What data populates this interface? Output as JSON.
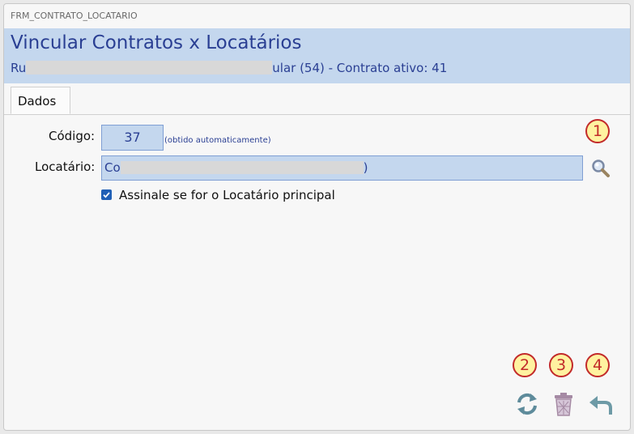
{
  "window": {
    "form_id": "FRM_CONTRATO_LOCATARIO"
  },
  "header": {
    "title": "Vincular Contratos x Locatários",
    "subtitle_prefix": "Ru",
    "subtitle_suffix": "ular (54) - Contrato ativo: 41"
  },
  "tabs": [
    {
      "label": "Dados",
      "active": true
    }
  ],
  "form": {
    "codigo_label": "Código:",
    "codigo_value": "37",
    "codigo_hint": "(obtido automaticamente)",
    "locatario_label": "Locatário:",
    "locatario_value_prefix": "Co",
    "locatario_value_suffix": ")",
    "principal_checkbox_label": "Assinale se for o Locatário principal",
    "principal_checked": true
  },
  "markers": [
    "1",
    "2",
    "3",
    "4"
  ],
  "actions": [
    {
      "icon": "refresh-icon"
    },
    {
      "icon": "trash-icon"
    },
    {
      "icon": "back-arrow-icon"
    }
  ],
  "colors": {
    "header_bg": "#c4d7ee",
    "title_text": "#2a3f93",
    "field_bg": "#c4d7ee",
    "marker_bg": "#fff2a0",
    "marker_border": "#c22a2a",
    "checkbox": "#1f5fb6"
  }
}
